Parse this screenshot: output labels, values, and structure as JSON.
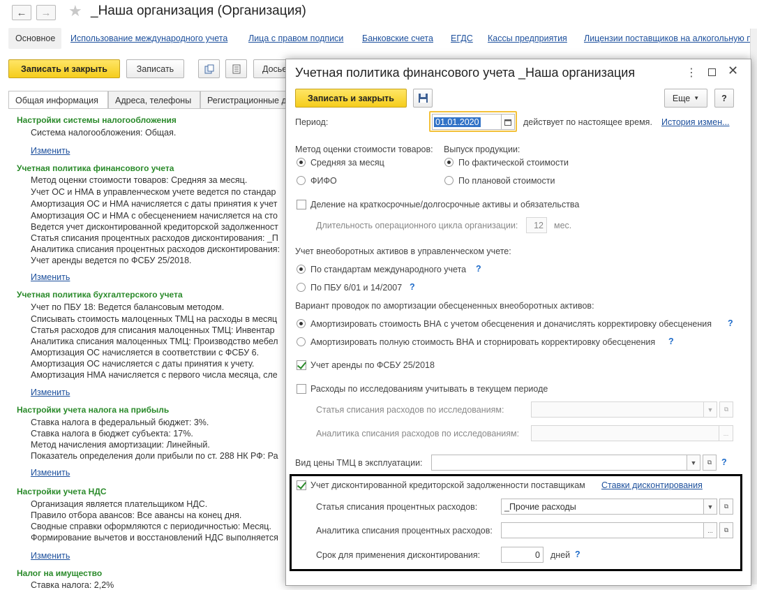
{
  "window": {
    "title": "_Наша организация (Организация)",
    "back_label": "←",
    "forward_label": "→",
    "star_label": "★"
  },
  "top_links": {
    "main": "Основное",
    "intl": "Использование международного учета",
    "signers": "Лица с правом подписи",
    "bank": "Банковские счета",
    "egds": "ЕГДС",
    "cash": "Кассы предприятия",
    "licenses": "Лицензии поставщиков на алкогольную п"
  },
  "toolbar": {
    "save_close": "Записать и закрыть",
    "save": "Записать",
    "more_docs": "Досье"
  },
  "tabs": {
    "general": "Общая информация",
    "address": "Адреса, телефоны",
    "reg": "Регистрационные д"
  },
  "sections": {
    "s1": {
      "title": "Настройки системы налогообложения",
      "l1": "Система налогообложения: Общая."
    },
    "s2": {
      "title": "Учетная политика финансового учета",
      "l1": "Метод оценки стоимости товаров: Средняя за месяц.",
      "l2": "Учет ОС и НМА в управленческом учете ведется по стандар",
      "l3": "Амортизация ОС и НМА начисляется с даты принятия к учет",
      "l4": "Амортизация  ОС и НМА с обесценением начисляется на сто",
      "l5": "Ведется учет дисконтированной кредиторской задолженност",
      "l6": "Статья списания процентных расходов дисконтирования: _П",
      "l7": "Аналитика списания процентных расходов дисконтирования:",
      "l8": "Учет аренды ведется по ФСБУ 25/2018."
    },
    "s3": {
      "title": "Учетная политика бухгалтерского учета",
      "l1": "Учет по ПБУ 18: Ведется балансовым методом.",
      "l2": "Списывать стоимость малоценных ТМЦ на расходы в месяц",
      "l3": "Статья расходов для списания малоценных ТМЦ: Инвентар",
      "l4": "Аналитика списания малоценных ТМЦ: Производство мебел",
      "l5": "Амортизация ОС начисляется в соответствии с ФСБУ 6.",
      "l6": "Амортизация ОС начисляется с даты принятия к учету.",
      "l7": "Амортизация НМА начисляется с первого числа месяца, сле"
    },
    "s4": {
      "title": "Настройки учета налога на прибыль",
      "l1": "Ставка налога в федеральный бюджет: 3%.",
      "l2": "Ставка налога в бюджет субъекта: 17%.",
      "l3": "Метод начисления амортизации: Линейный.",
      "l4": "Показатель определения доли прибыли по ст. 288 НК РФ: Ра"
    },
    "s5": {
      "title": "Настройки учета НДС",
      "l1": "Организация является плательщиком НДС.",
      "l2": "Правило отбора авансов: Все авансы на конец дня.",
      "l3": "Сводные справки оформляются с периодичностью: Месяц.",
      "l4": "Формирование вычетов и восстановлений НДС выполняется"
    },
    "s6": {
      "title": "Налог на имущество",
      "l1": "Ставка налога: 2,2%"
    },
    "edit_label": "Изменить"
  },
  "dialog": {
    "title": "Учетная политика финансового учета _Наша организация",
    "save_close": "Записать и закрыть",
    "more": "Еще",
    "help": "?",
    "period_label": "Период:",
    "period_value": "01.01.2020",
    "period_note": "действует по настоящее время.",
    "history_link": "История измен...",
    "method_label": "Метод оценки стоимости товаров:",
    "method_avg": "Средняя за месяц",
    "method_fifo": "ФИФО",
    "output_label": "Выпуск продукции:",
    "output_actual": "По фактической стоимости",
    "output_plan": "По плановой стоимости",
    "split_assets": "Деление на краткосрочные/долгосрочные активы и обязательства",
    "cycle_label": "Длительность операционного цикла организации:",
    "cycle_value": "12",
    "cycle_unit": "мес.",
    "noncurrent_label": "Учет внеоборотных активов в управленческом учете:",
    "noncurrent_ifrs": "По стандартам международного учета",
    "noncurrent_pbu": "По ПБУ 6/01 и 14/2007",
    "impair_label": "Вариант проводок по амортизации обесцененных внеоборотных активов:",
    "impair_opt1": "Амортизировать стоимость ВНА с учетом обесценения и доначислять корректировку обесценения",
    "impair_opt2": "Амортизировать полную стоимость ВНА и сторнировать корректировку обесценения",
    "lease": "Учет аренды по ФСБУ 25/2018",
    "research": "Расходы по исследованиям учитывать в текущем периоде",
    "research_item": "Статья списания расходов по исследованиям:",
    "research_analytics": "Аналитика списания расходов по исследованиям:",
    "tmc_price": "Вид цены ТМЦ в эксплуатации:",
    "discount": "Учет дисконтированной кредиторской задолженности поставщикам",
    "discount_rates": "Ставки дисконтирования",
    "interest_item": "Статья списания процентных расходов:",
    "interest_item_value": "_Прочие расходы",
    "interest_analytics": "Аналитика списания процентных расходов:",
    "term_label": "Срок для применения дисконтирования:",
    "term_value": "0",
    "term_unit": "дней"
  },
  "colors": {
    "accent_yellow": "#f5cd1c",
    "link": "#1c4f9c",
    "section_green": "#2a8a2a",
    "highlight_box": "#000000"
  }
}
